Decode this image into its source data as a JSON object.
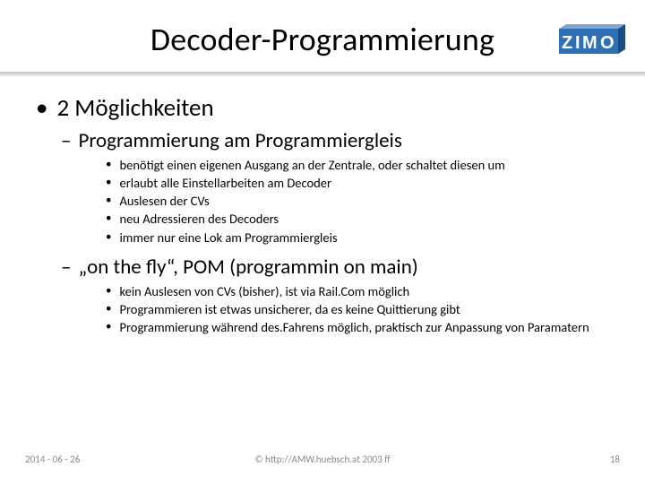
{
  "brand": {
    "name": "ZIMO",
    "colors": {
      "face": "#2f6fb3",
      "side": "#1b4d85",
      "top": "#79a8d6"
    }
  },
  "title": "Decoder-Programmierung",
  "lvl1": "2 Möglichkeiten",
  "section1": {
    "heading": "Programmierung am Programmiergleis",
    "items": [
      "benötigt einen eigenen Ausgang an der Zentrale, oder schaltet diesen um",
      "erlaubt alle Einstellarbeiten am Decoder",
      "Auslesen der CVs",
      "neu Adressieren des Decoders",
      "immer nur eine Lok am Programmiergleis"
    ]
  },
  "section2": {
    "heading": "„on the fly“, POM (programmin on main)",
    "items": [
      "kein Auslesen von CVs (bisher), ist via Rail.Com möglich",
      " Programmieren ist etwas unsicherer, da es keine Quittierung gibt",
      "Programmierung während des.Fahrens möglich, praktisch zur Anpassung von Paramatern"
    ]
  },
  "footer": {
    "date": "2014 - 06 - 26",
    "copyright": "© http://AMW.huebsch.at 2003 ff",
    "page": "18"
  }
}
